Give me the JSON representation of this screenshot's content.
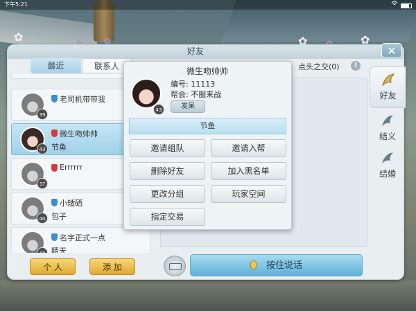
{
  "statusbar": {
    "time": "下午5:21"
  },
  "panel": {
    "title": "好友",
    "close": "✕"
  },
  "tabs": {
    "recent": "最近",
    "contacts": "联系人"
  },
  "friends": [
    {
      "name": "老司机带带我",
      "level": "39",
      "badge": "blue",
      "sub": ""
    },
    {
      "name": "微生吻帅帅",
      "level": "43",
      "badge": "red",
      "sub": "节鱼",
      "selected": true
    },
    {
      "name": "Errrrrr",
      "level": "37",
      "badge": "red",
      "sub": ""
    },
    {
      "name": "小矮硒",
      "level": "40",
      "badge": "blue",
      "sub": "包子"
    },
    {
      "name": "名字正式一点",
      "level": "40",
      "badge": "blue",
      "sub": "睛天"
    }
  ],
  "bottom": {
    "me": "个 人",
    "add": "添 加"
  },
  "chat": {
    "title": "点头之交(0)",
    "info": "!",
    "voice": "按住说话"
  },
  "side_tabs": {
    "friends": "好友",
    "sworn": "结义",
    "marry": "结婚"
  },
  "popup": {
    "name": "微生吻帅帅",
    "level": "43",
    "id_line": "编号: 11113",
    "guild_line": "帮会: 不服来战",
    "send": "发呆",
    "group": "节鱼",
    "buttons": {
      "invite_team": "邀请组队",
      "invite_guild": "邀请入帮",
      "delete": "删除好友",
      "blacklist": "加入黑名单",
      "change_group": "更改分组",
      "space": "玩家空间",
      "trade": "指定交易"
    }
  }
}
